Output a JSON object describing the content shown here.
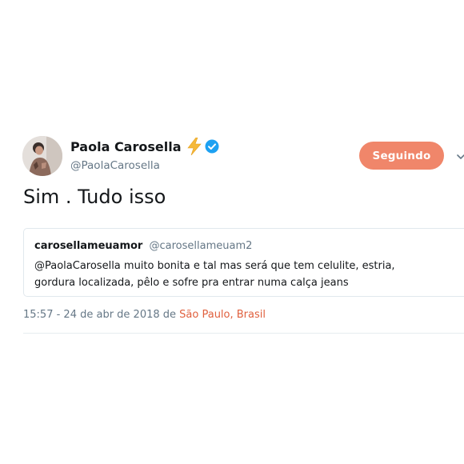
{
  "author": {
    "display_name": "Paola Carosella",
    "handle": "@PaolaCarosella",
    "emoji_icon": "high-voltage-icon",
    "verified": true
  },
  "follow_button": {
    "label": "Seguindo",
    "color": "#f0866a"
  },
  "tweet": {
    "text": "Sim . Tudo isso"
  },
  "quoted_tweet": {
    "author_name": "carosellameuamor",
    "author_handle": "@carosellameuam2",
    "text": "@PaolaCarosella muito bonita e tal mas será que tem celulite, estria, gordura localizada, pêlo e sofre pra entrar numa calça jeans"
  },
  "meta": {
    "timestamp": "15:57 - 24 de abr de 2018",
    "location_prefix": "de",
    "location": "São Paulo, Brasil",
    "location_color": "#e0603e"
  },
  "colors": {
    "verified": "#1da1f2",
    "bolt": "#f5b93a",
    "secondary_text": "#657786"
  }
}
